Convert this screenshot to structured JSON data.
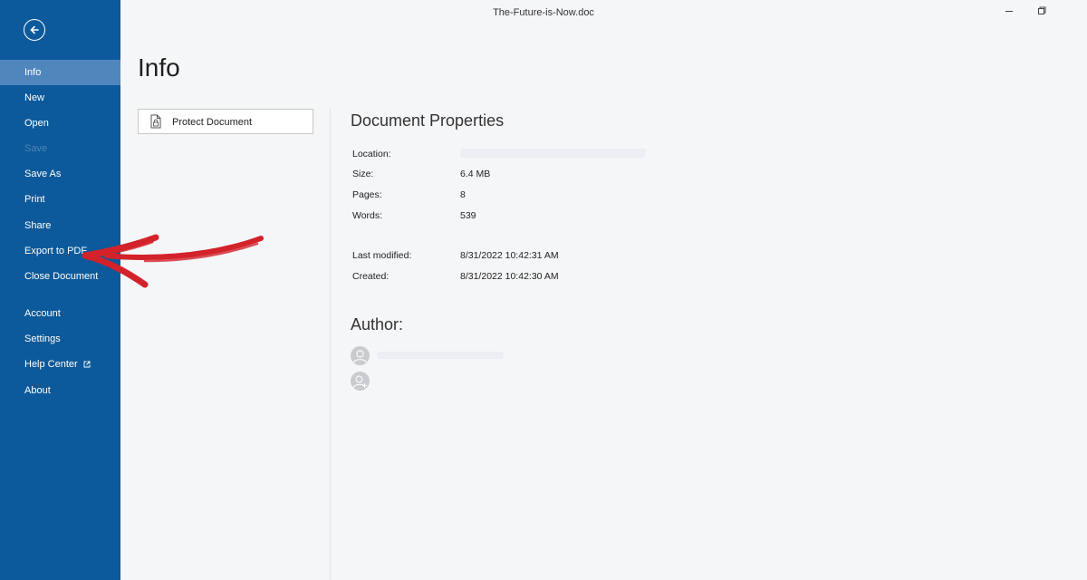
{
  "window": {
    "title": "The-Future-is-Now.doc",
    "controls": [
      "minimize-icon",
      "restore-icon"
    ]
  },
  "sidebar": {
    "back_icon": "arrow-left-circle-icon",
    "items": [
      {
        "label": "Info",
        "state": "active"
      },
      {
        "label": "New"
      },
      {
        "label": "Open"
      },
      {
        "label": "Save",
        "state": "disabled"
      },
      {
        "label": "Save As"
      },
      {
        "label": "Print"
      },
      {
        "label": "Share"
      },
      {
        "label": "Export to PDF"
      },
      {
        "label": "Close Document"
      },
      {
        "label": "Account"
      },
      {
        "label": "Settings"
      },
      {
        "label": "Help Center",
        "icon": "external-link-icon"
      },
      {
        "label": "About"
      }
    ]
  },
  "main": {
    "title": "Info",
    "protect_button": {
      "label": "Protect Document",
      "icon": "lock-document-icon"
    },
    "properties": {
      "heading": "Document Properties",
      "items": [
        {
          "label": "Location:",
          "value": ""
        },
        {
          "label": "Size:",
          "value": "6.4 MB"
        },
        {
          "label": "Pages:",
          "value": "8"
        },
        {
          "label": "Words:",
          "value": "539"
        },
        {
          "label": "Last modified:",
          "value": "8/31/2022 10:42:31 AM"
        },
        {
          "label": "Created:",
          "value": "8/31/2022 10:42:30 AM"
        }
      ]
    },
    "author": {
      "heading": "Author:",
      "icons": [
        "user-avatar-icon",
        "add-user-icon"
      ]
    }
  },
  "colors": {
    "sidebar_bg": "#0c5a9b",
    "sidebar_active": "#4f87bd",
    "page_bg": "#f5f6f8",
    "annotation_arrow": "#d3222a"
  }
}
